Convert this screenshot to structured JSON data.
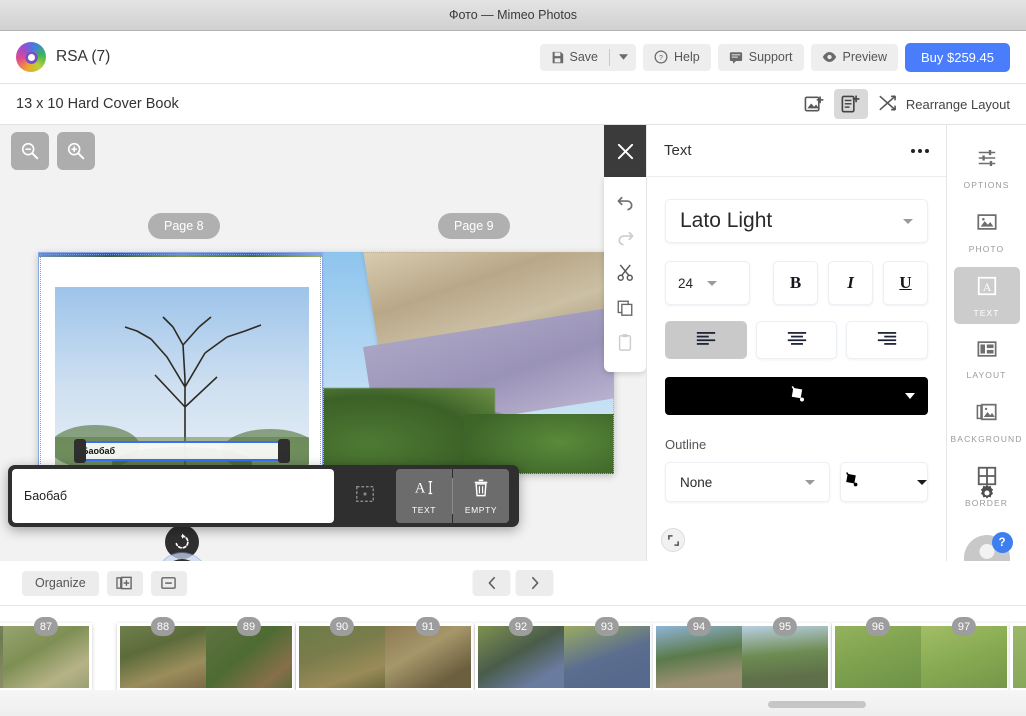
{
  "window": {
    "title": "Фото — Mimeo Photos"
  },
  "header": {
    "brand": "RSA (7)",
    "logo_icon": "mimeo-logo-icon",
    "buttons": {
      "save": "Save",
      "save_dropdown_icon": "chevron-down-icon",
      "help": "Help",
      "support": "Support",
      "preview": "Preview",
      "buy": "Buy $259.45"
    },
    "accent_color": "#4a7dfb"
  },
  "subheader": {
    "doc_title": "13 x 10 Hard Cover Book",
    "add_photo_icon": "add-photo-icon",
    "add_page_icon": "add-page-icon",
    "rearrange_icon": "shuffle-icon",
    "rearrange_label": "Rearrange Layout"
  },
  "canvas": {
    "zoom_out_icon": "zoom-out-icon",
    "zoom_in_icon": "zoom-in-icon",
    "page_left_label": "Page 8",
    "page_right_label": "Page 9",
    "selected_text_value": "Баобаб",
    "rotate_icon": "rotate-icon",
    "move_icon": "move-icon",
    "selection_color": "#3b6ef5"
  },
  "edit_popup": {
    "input_value": "Баобаб",
    "frame_icon": "frame-icon",
    "text_button_icon": "text-cursor-icon",
    "text_button_label": "TEXT",
    "empty_button_icon": "trash-icon",
    "empty_button_label": "EMPTY"
  },
  "edit_toolbar": {
    "close_icon": "close-icon",
    "undo_icon": "undo-icon",
    "redo_icon": "redo-icon",
    "cut_icon": "scissors-icon",
    "copy_icon": "copy-icon",
    "paste_icon": "paste-icon"
  },
  "text_panel": {
    "title": "Text",
    "overflow_icon": "more-horizontal-icon",
    "font_family": "Lato Light",
    "font_size": "24",
    "bold_label": "B",
    "italic_label": "I",
    "underline_label": "U",
    "align_left_icon": "align-left-icon",
    "align_center_icon": "align-center-icon",
    "align_right_icon": "align-right-icon",
    "fill_icon": "paint-bucket-icon",
    "fill_color": "#000000",
    "outline_label": "Outline",
    "outline_value": "None",
    "outline_color_icon": "paint-bucket-icon",
    "collapse_icon": "collapse-icon"
  },
  "rail": {
    "items": [
      {
        "label": "OPTIONS",
        "icon": "sliders-icon",
        "selected": false
      },
      {
        "label": "PHOTO",
        "icon": "image-icon",
        "selected": false
      },
      {
        "label": "TEXT",
        "icon": "letter-a-icon",
        "selected": true
      },
      {
        "label": "LAYOUT",
        "icon": "layout-grid-icon",
        "selected": false
      },
      {
        "label": "BACKGROUND",
        "icon": "layers-image-icon",
        "selected": false
      },
      {
        "label": "BORDER",
        "icon": "border-grid-icon",
        "selected": false
      }
    ],
    "gear_icon": "gear-icon",
    "avatar_icon": "avatar-icon",
    "help_badge": "?",
    "badge_color": "#3d7ef0"
  },
  "filmstrip_toolbar": {
    "organize_label": "Organize",
    "add_spread_icon": "add-spread-icon",
    "remove_spread_icon": "remove-spread-icon",
    "prev_icon": "chevron-left-icon",
    "next_icon": "chevron-right-icon"
  },
  "filmstrip": {
    "spreads": [
      {
        "left": "87",
        "right": ""
      },
      {
        "left": "88",
        "right": "89"
      },
      {
        "left": "90",
        "right": "91"
      },
      {
        "left": "92",
        "right": "93"
      },
      {
        "left": "94",
        "right": "95"
      },
      {
        "left": "96",
        "right": "97"
      }
    ],
    "scrollbar": "horizontal-scrollbar"
  }
}
